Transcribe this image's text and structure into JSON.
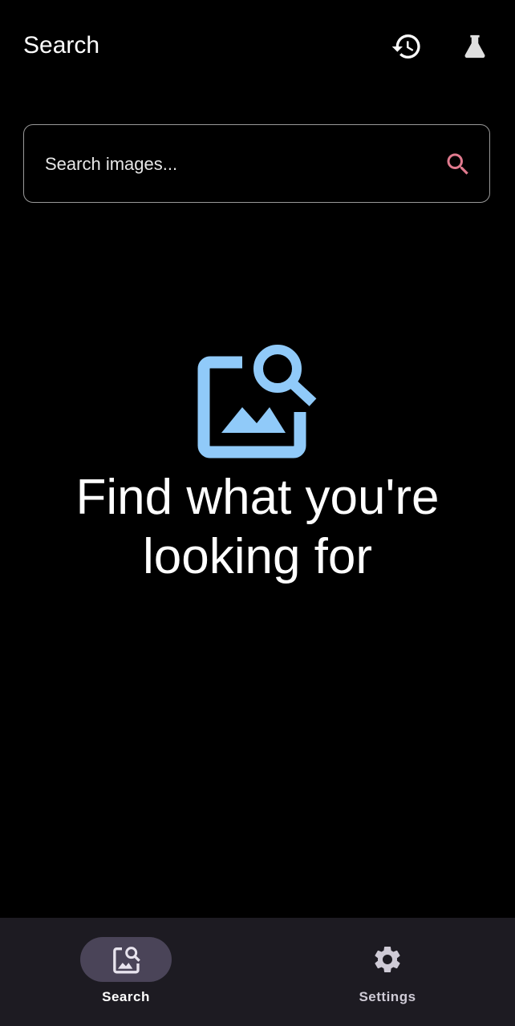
{
  "app_bar": {
    "title": "Search",
    "actions": [
      {
        "icon": "history-icon",
        "label": "History"
      },
      {
        "icon": "flask-icon",
        "label": "Labs"
      }
    ]
  },
  "search": {
    "placeholder": "Search images...",
    "value": "",
    "icon": "search-icon",
    "icon_color": "#e07a8e"
  },
  "empty_state": {
    "icon": "image-search-icon",
    "icon_color": "#90caf9",
    "heading": "Find what you're looking for"
  },
  "bottom_nav": {
    "items": [
      {
        "label": "Search",
        "icon": "image-search-icon",
        "selected": true
      },
      {
        "label": "Settings",
        "icon": "gear-icon",
        "selected": false
      }
    ]
  },
  "colors": {
    "background": "#000000",
    "nav_background": "#1d1b22",
    "nav_indicator": "#4a4458",
    "accent_blue": "#90caf9",
    "accent_pink": "#e07a8e"
  }
}
